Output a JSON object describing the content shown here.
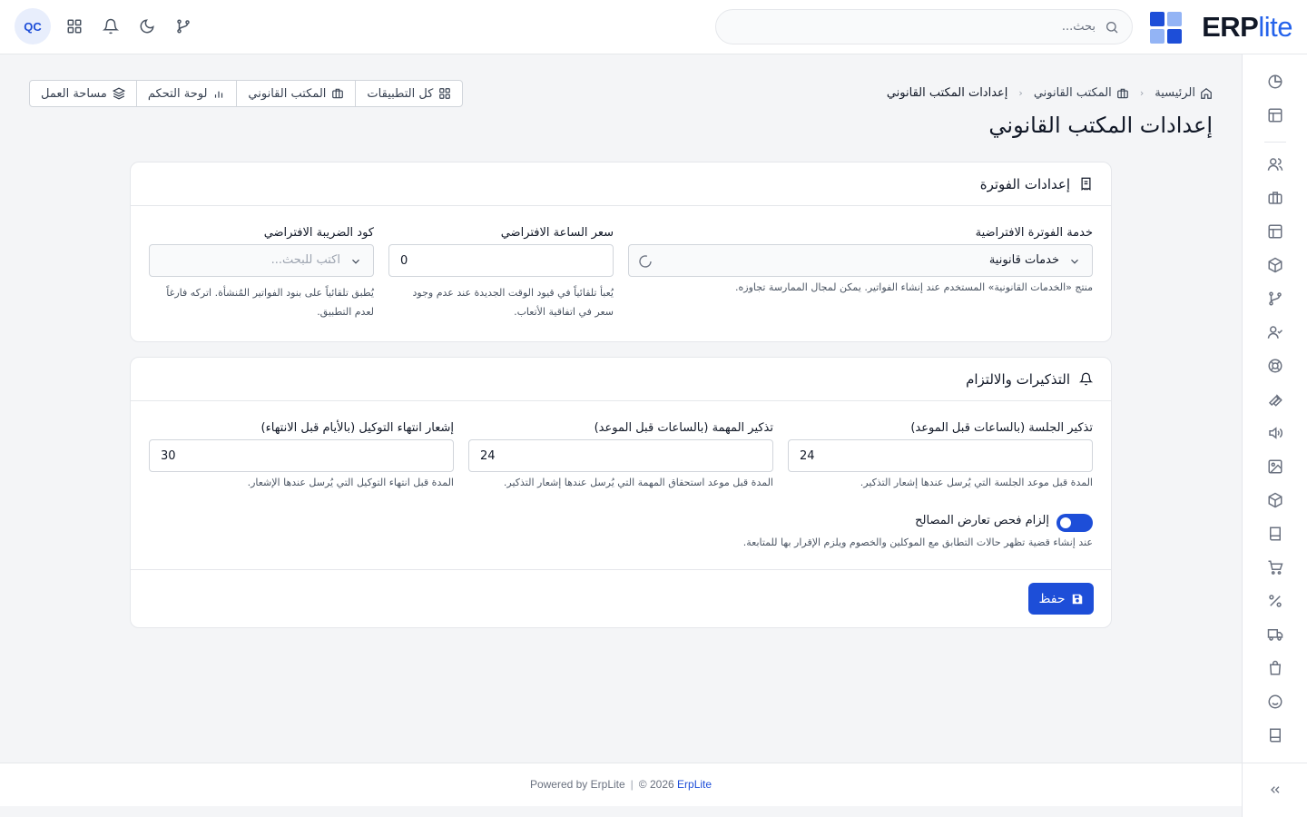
{
  "header": {
    "logo": {
      "bold": "ERP",
      "light": "lite"
    },
    "search": {
      "placeholder": "بحث..."
    },
    "avatar": "QC",
    "icons": [
      "branch-icon",
      "moon-icon",
      "bell-icon",
      "apps-grid-icon"
    ]
  },
  "breadcrumb": {
    "home": "الرئيسية",
    "section": "المكتب القانوني",
    "current": "إعدادات المكتب القانوني"
  },
  "page": {
    "title": "إعدادات المكتب القانوني"
  },
  "quick_nav": {
    "apps": "كل التطبيقات",
    "legal": "المكتب القانوني",
    "dashboard": "لوحة التحكم",
    "workspace": "مساحة العمل"
  },
  "invoice_settings": {
    "title": "إعدادات الفوترة",
    "default_service": {
      "label": "خدمة الفوترة الافتراضية",
      "value": "خدمات قانونية",
      "help": "منتج «الخدمات القانونية» المستخدم عند إنشاء الفواتير. يمكن لمجال الممارسة تجاوزه."
    },
    "hourly_rate": {
      "label": "سعر الساعة الافتراضي",
      "value": "0",
      "help_line1": "يُعبأ تلقائياً في قيود الوقت الجديدة عند عدم وجود",
      "help_line2": "سعر في اتفاقية الأتعاب."
    },
    "tax_code": {
      "label": "كود الضريبة الافتراضي",
      "placeholder": "اكتب للبحث...",
      "help_line1": "يُطبق تلقائياً على بنود الفواتير المُنشأة. اتركه فارغاً",
      "help_line2": "لعدم التطبيق."
    }
  },
  "reminders": {
    "title": "التذكيرات والالتزام",
    "session_reminder": {
      "label": "تذكير الجلسة (بالساعات قبل الموعد)",
      "value": "24",
      "help": "المدة قبل موعد الجلسة التي يُرسل عندها إشعار التذكير."
    },
    "task_reminder": {
      "label": "تذكير المهمة (بالساعات قبل الموعد)",
      "value": "24",
      "help": "المدة قبل موعد استحقاق المهمة التي يُرسل عندها إشعار التذكير."
    },
    "poa_expiry": {
      "label": "إشعار انتهاء التوكيل (بالأيام قبل الانتهاء)",
      "value": "30",
      "help": "المدة قبل انتهاء التوكيل التي يُرسل عندها الإشعار."
    },
    "conflict_check": {
      "label": "إلزام فحص تعارض المصالح",
      "help": "عند إنشاء قضية تظهر حالات التطابق مع الموكلين والخصوم ويلزم الإقرار بها للمتابعة.",
      "enabled": true
    },
    "save_label": "حفظ"
  },
  "footer": {
    "year_text": "© 2026",
    "brand": "ErpLite",
    "powered": "Powered by ErpLite"
  },
  "colors": {
    "primary": "#1d4ed8",
    "logo_dark": "#1d4ed8",
    "logo_light": "#93b4f5"
  }
}
